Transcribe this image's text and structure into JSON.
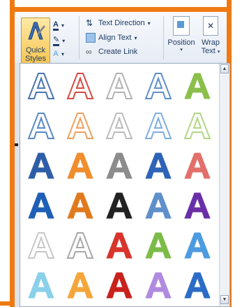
{
  "ribbon": {
    "quick_styles": {
      "line1": "Quick",
      "line2": "Styles"
    },
    "text_direction": "Text Direction",
    "align_text": "Align Text",
    "create_link": "Create Link",
    "position": "Position",
    "wrap_text": {
      "line1": "Wrap",
      "line2": "Text"
    }
  },
  "gallery": {
    "rows": [
      [
        {
          "name": "style-1-1",
          "color": "#4a74b4"
        },
        {
          "name": "style-1-2",
          "color": "#d94a43"
        },
        {
          "name": "style-1-3",
          "color": "#b3b3b3"
        },
        {
          "name": "style-1-4",
          "color": "#5f8fcb"
        },
        {
          "name": "style-1-5",
          "color": "#8bbf4b"
        }
      ],
      [
        {
          "name": "style-2-1",
          "color": "#5a88c8"
        },
        {
          "name": "style-2-2",
          "color": "#f1a05e"
        },
        {
          "name": "style-2-3",
          "color": "#bcbcbc"
        },
        {
          "name": "style-2-4",
          "color": "#7faee0"
        },
        {
          "name": "style-2-5",
          "color": "#b4d684"
        }
      ],
      [
        {
          "name": "style-3-1",
          "color": "#2f5ea8"
        },
        {
          "name": "style-3-2",
          "color": "#f08d2d"
        },
        {
          "name": "style-3-3",
          "color": "#8c8c8c"
        },
        {
          "name": "style-3-4",
          "color": "#2e64b7"
        },
        {
          "name": "style-3-5",
          "color": "#e36f6a"
        }
      ],
      [
        {
          "name": "style-4-1",
          "color": "#1f5fb5"
        },
        {
          "name": "style-4-2",
          "color": "#e07a1d"
        },
        {
          "name": "style-4-3",
          "color": "#222222"
        },
        {
          "name": "style-4-4",
          "color": "#5f8fcb"
        },
        {
          "name": "style-4-5",
          "color": "#6a2fa8"
        }
      ],
      [
        {
          "name": "style-5-1",
          "color": "#c8c8c8"
        },
        {
          "name": "style-5-2",
          "color": "#a8a8a8"
        },
        {
          "name": "style-5-3",
          "color": "#d8342b"
        },
        {
          "name": "style-5-4",
          "color": "#7dbb47"
        },
        {
          "name": "style-5-5",
          "color": "#4d9be0"
        }
      ],
      [
        {
          "name": "style-6-1",
          "color": "#8ad0ea"
        },
        {
          "name": "style-6-2",
          "color": "#f5a63b"
        },
        {
          "name": "style-6-3",
          "color": "#c8221c"
        },
        {
          "name": "style-6-4",
          "color": "#b08ae0"
        },
        {
          "name": "style-6-5",
          "color": "#2c6cc7"
        }
      ]
    ]
  }
}
